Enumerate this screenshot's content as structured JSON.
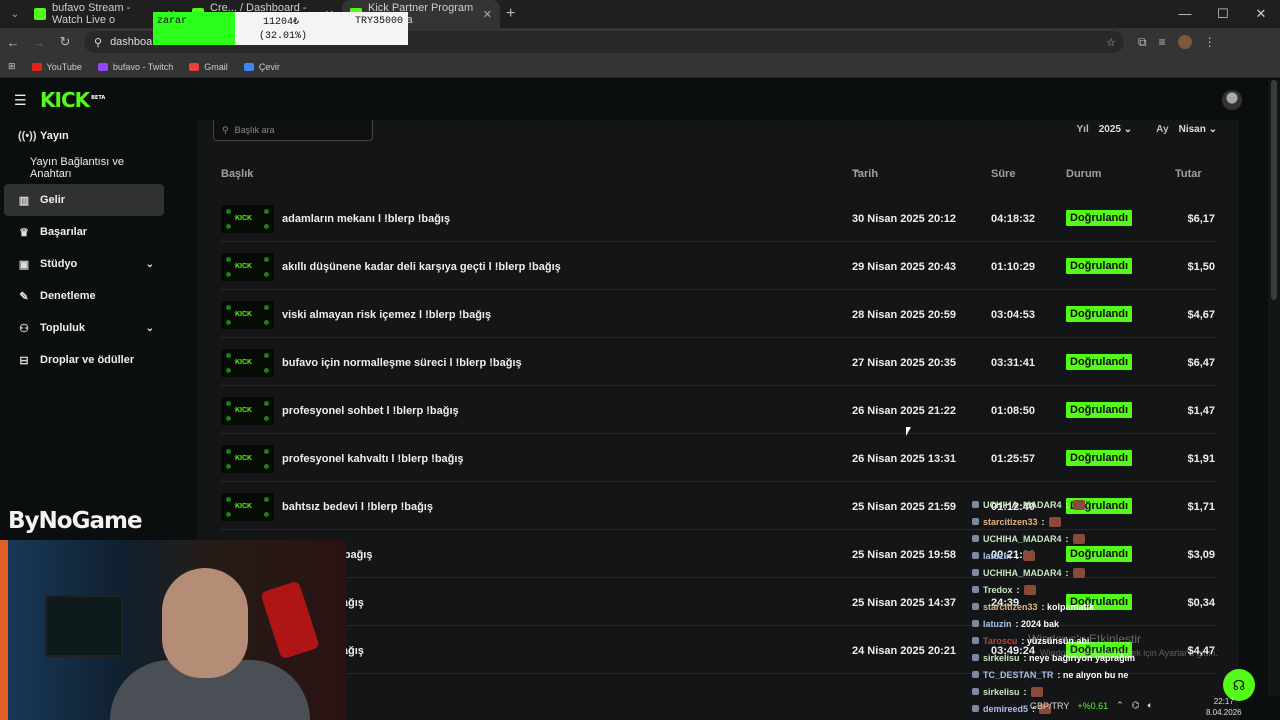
{
  "browser": {
    "tabs": [
      {
        "label": "bufavo Stream - Watch Live o",
        "active": false
      },
      {
        "label": "Cre... / Dashboard - Kick Y...",
        "active": false
      },
      {
        "label": "Kick Partner Program - Kick Da",
        "active": true
      }
    ],
    "url": "dashboard.kick.com",
    "bookmarks": [
      "YouTube",
      "bufavo - Twitch",
      "Gmail",
      "Çevir"
    ]
  },
  "ticker": {
    "label": "zarar",
    "price": "11204₺",
    "percent": "(32.01%)",
    "symbol": "TRY35000"
  },
  "app": {
    "logo": "KICK",
    "logo_tag": "BETA"
  },
  "sidebar": {
    "items": [
      {
        "label": "Yayın",
        "icon": "broadcast-icon"
      },
      {
        "label": "Yayın Bağlantısı ve Anahtarı",
        "sub": true
      },
      {
        "label": "Gelir",
        "icon": "chart-icon",
        "active": true
      },
      {
        "label": "Başarılar",
        "icon": "trophy-icon"
      },
      {
        "label": "Stüdyo",
        "icon": "studio-icon",
        "chevron": true
      },
      {
        "label": "Denetleme",
        "icon": "wrench-icon"
      },
      {
        "label": "Topluluk",
        "icon": "people-icon",
        "chevron": true
      },
      {
        "label": "Droplar ve ödüller",
        "icon": "gift-icon"
      }
    ]
  },
  "filters": {
    "search_placeholder": "Başlık ara",
    "year_label": "Yıl",
    "year_value": "2025",
    "month_label": "Ay",
    "month_value": "Nisan"
  },
  "table": {
    "headers": {
      "title": "Başlık",
      "date": "Tarih",
      "duration": "Süre",
      "status": "Durum",
      "amount": "Tutar"
    },
    "rows": [
      {
        "title": "adamların mekanı l !blerp !bağış",
        "date": "30 Nisan 2025 20:12",
        "duration": "04:18:32",
        "status": "Doğrulandı",
        "amount": "$6,17"
      },
      {
        "title": "akıllı düşünene kadar deli karşıya geçti l !blerp !bağış",
        "date": "29 Nisan 2025 20:43",
        "duration": "01:10:29",
        "status": "Doğrulandı",
        "amount": "$1,50"
      },
      {
        "title": "viski almayan risk içemez l !blerp !bağış",
        "date": "28 Nisan 2025 20:59",
        "duration": "03:04:53",
        "status": "Doğrulandı",
        "amount": "$4,67"
      },
      {
        "title": "bufavo için normalleşme süreci l !blerp !bağış",
        "date": "27 Nisan 2025 20:35",
        "duration": "03:31:41",
        "status": "Doğrulandı",
        "amount": "$6,47"
      },
      {
        "title": "profesyonel sohbet l !blerp !bağış",
        "date": "26 Nisan 2025 21:22",
        "duration": "01:08:50",
        "status": "Doğrulandı",
        "amount": "$1,47"
      },
      {
        "title": "profesyonel kahvaltı l !blerp !bağış",
        "date": "26 Nisan 2025 13:31",
        "duration": "01:25:57",
        "status": "Doğrulandı",
        "amount": "$1,91"
      },
      {
        "title": "bahtsız bedevi l !blerp !bağış",
        "date": "25 Nisan 2025 21:59",
        "duration": "01:12:40",
        "status": "Doğrulandı",
        "amount": "$1,71"
      },
      {
        "title": "evi l !blerp !bağış",
        "date": "25 Nisan 2025 19:58",
        "duration": "00:21:01",
        "status": "Doğrulandı",
        "amount": "$3,09"
      },
      {
        "title": "u l !blerp !bağış",
        "date": "25 Nisan 2025 14:37",
        "duration": "24:39",
        "status": "Doğrulandı",
        "amount": "$0,34"
      },
      {
        "title": "u l !blerp !bağış",
        "date": "24 Nisan 2025 20:21",
        "duration": "03:49:24",
        "status": "Doğrulandı",
        "amount": "$4,47"
      }
    ]
  },
  "overlay": {
    "brand": "ByNoGame",
    "watermark": "Windows'u Etkinleştir",
    "watermark_sub": "Windows'u etkinleştirmek için Ayarlar'a gidin."
  },
  "chat": [
    {
      "user": "UCHIHA_MADAR4",
      "msg": ":",
      "color": "g"
    },
    {
      "user": "starcitizen33",
      "msg": ":",
      "color": "o"
    },
    {
      "user": "UCHIHA_MADAR4",
      "msg": ":",
      "color": "g"
    },
    {
      "user": "latuzin",
      "msg": ":",
      "color": "b"
    },
    {
      "user": "UCHIHA_MADAR4",
      "msg": ":",
      "color": "g"
    },
    {
      "user": "Tredox",
      "msg": ":",
      "color": "g"
    },
    {
      "user": "starcitizen33",
      "msg": ": kolpamatik",
      "color": "o"
    },
    {
      "user": "latuzin",
      "msg": ": 2024 bak",
      "color": "b"
    },
    {
      "user": "Taroscu",
      "msg": ": yüzsünsün abi",
      "color": "r"
    },
    {
      "user": "sirkelisu",
      "msg": ": neye bağırıyon yaprağım",
      "color": "g"
    },
    {
      "user": "TC_DESTAN_TR",
      "msg": ": ne alıyon bu ne",
      "color": "b"
    },
    {
      "user": "sirkelisu",
      "msg": ":",
      "color": "g"
    },
    {
      "user": "demireed5",
      "msg": ":",
      "color": "b"
    }
  ],
  "taskbar": {
    "currency": "GBP/TRY",
    "change": "+%0.61",
    "time": "22:17",
    "date": "8.04.2026"
  }
}
